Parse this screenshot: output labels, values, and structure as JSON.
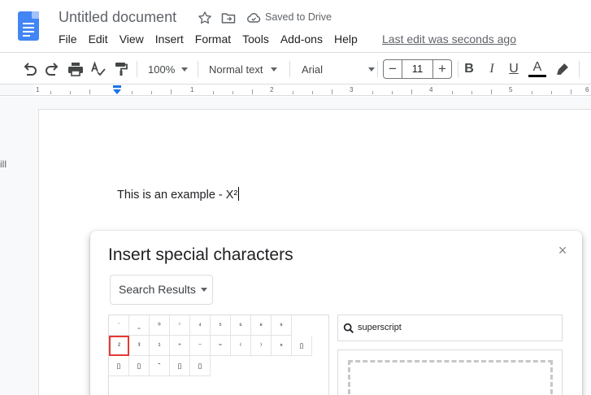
{
  "header": {
    "title": "Untitled document",
    "saved_status": "Saved to Drive",
    "last_edit": "Last edit was seconds ago",
    "menu": [
      "File",
      "Edit",
      "View",
      "Insert",
      "Format",
      "Tools",
      "Add-ons",
      "Help"
    ]
  },
  "toolbar": {
    "zoom": "100%",
    "style": "Normal text",
    "font": "Arial",
    "font_size": "11",
    "minus": "−",
    "plus": "+",
    "bold": "B",
    "italic": "I",
    "underline": "U",
    "text_color_letter": "A",
    "text_color": "#000000"
  },
  "ruler": {
    "ticks": [
      "1",
      "1",
      "2",
      "3",
      "4",
      "5",
      "6"
    ]
  },
  "document": {
    "side_fragment": "ill",
    "body_text": "This is an example - X²"
  },
  "dialog": {
    "title": "Insert special characters",
    "close": "×",
    "category": "Search Results",
    "search_value": "superscript",
    "rows": [
      [
        "ˈ",
        "˷",
        "⁰",
        "ⁱ",
        "⁴",
        "⁵",
        "⁶",
        "⁸",
        "⁹"
      ],
      [
        "²",
        "³",
        "¹",
        "⁺",
        "⁻",
        "⁼",
        "⁽",
        "⁾",
        "ⁿ",
        "▯"
      ],
      [
        "▯",
        "▯",
        "˘",
        "▯",
        "▯"
      ]
    ],
    "selected_char": "²"
  },
  "colors": {
    "accent_blue": "#4285f4",
    "selection_red": "#e53935"
  }
}
